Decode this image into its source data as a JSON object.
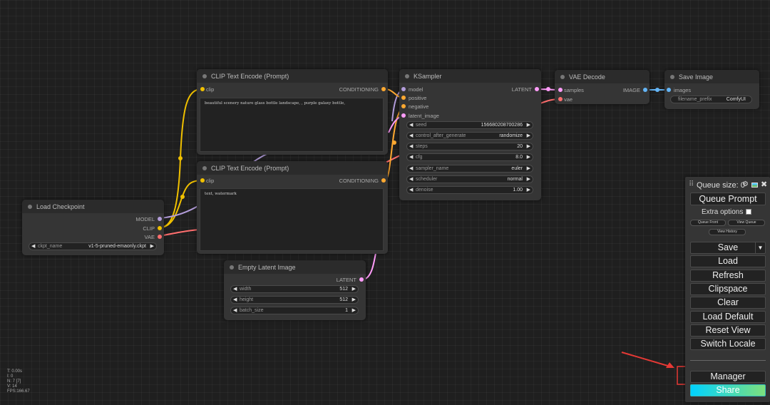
{
  "nodes": {
    "clip_top": {
      "title": "CLIP Text Encode (Prompt)",
      "input": "clip",
      "output": "CONDITIONING",
      "text": "beautiful scenery nature glass bottle landscape, , purple galaxy bottle,"
    },
    "clip_bottom": {
      "title": "CLIP Text Encode (Prompt)",
      "input": "clip",
      "output": "CONDITIONING",
      "text": "text, watermark"
    },
    "ksampler": {
      "title": "KSampler",
      "inputs": [
        "model",
        "positive",
        "negative",
        "latent_image"
      ],
      "output": "LATENT",
      "widgets": [
        {
          "name": "seed",
          "value": "156680208700286"
        },
        {
          "name": "control_after_generate",
          "value": "randomize"
        },
        {
          "name": "steps",
          "value": "20"
        },
        {
          "name": "cfg",
          "value": "8.0"
        },
        {
          "name": "sampler_name",
          "value": "euler"
        },
        {
          "name": "scheduler",
          "value": "normal"
        },
        {
          "name": "denoise",
          "value": "1.00"
        }
      ]
    },
    "vae_decode": {
      "title": "VAE Decode",
      "inputs": [
        "samples",
        "vae"
      ],
      "output": "IMAGE"
    },
    "save_image": {
      "title": "Save Image",
      "input": "images",
      "widget": {
        "name": "filename_prefix",
        "value": "ComfyUI"
      }
    },
    "load_checkpoint": {
      "title": "Load Checkpoint",
      "outputs": [
        "MODEL",
        "CLIP",
        "VAE"
      ],
      "widget": {
        "name": "ckpt_name",
        "value": "v1-5-pruned-emaonly.ckpt"
      }
    },
    "empty_latent": {
      "title": "Empty Latent Image",
      "output": "LATENT",
      "widgets": [
        {
          "name": "width",
          "value": "512"
        },
        {
          "name": "height",
          "value": "512"
        },
        {
          "name": "batch_size",
          "value": "1"
        }
      ]
    }
  },
  "menu": {
    "queue_size": "Queue size: 0",
    "queue_prompt": "Queue Prompt",
    "extra_options": "Extra options",
    "queue_front": "Queue Front",
    "view_queue": "View Queue",
    "view_history": "View History",
    "save": "Save",
    "load": "Load",
    "refresh": "Refresh",
    "clipspace": "Clipspace",
    "clear": "Clear",
    "load_default": "Load Default",
    "reset_view": "Reset View",
    "switch_locale": "Switch Locale",
    "manager": "Manager",
    "share": "Share"
  },
  "stats": {
    "t": "T: 0.00s",
    "i": "I: 0",
    "n": "N: 7 [7]",
    "v": "V: 14",
    "fps": "FPS:166.67"
  },
  "colors": {
    "clip_link": "#f0c000",
    "model_link": "#b39ddb",
    "vae_link": "#ff6e6e",
    "conditioning_link": "#ffa931",
    "latent_link": "#ff9cf9",
    "image_link": "#64b5f6",
    "annotation": "#e53935"
  }
}
